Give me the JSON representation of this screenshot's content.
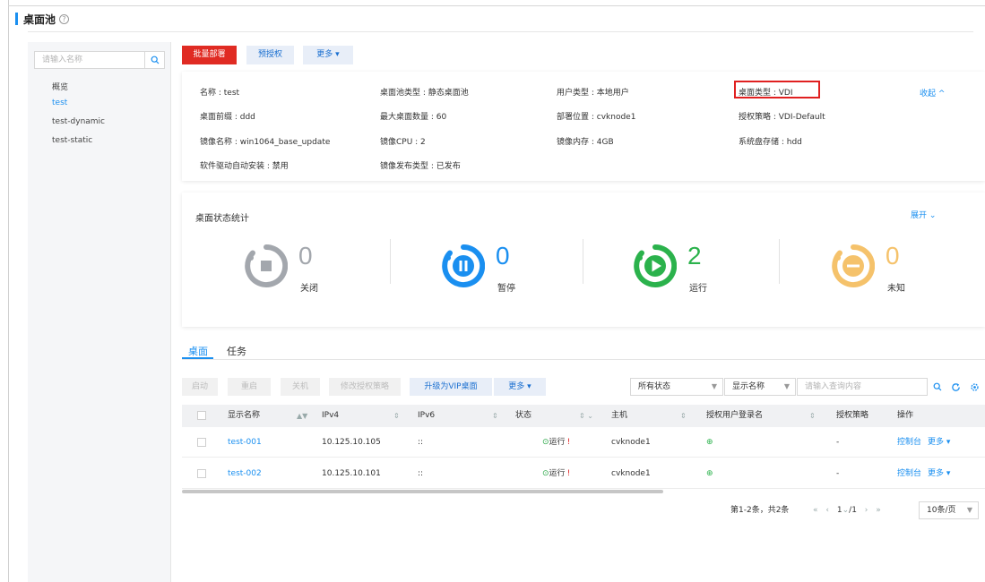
{
  "page": {
    "title": "桌面池",
    "help": "?"
  },
  "sidebar": {
    "search_placeholder": "请输入名称",
    "items": [
      {
        "label": "概览",
        "active": false
      },
      {
        "label": "test",
        "active": true
      },
      {
        "label": "test-dynamic",
        "active": false
      },
      {
        "label": "test-static",
        "active": false
      }
    ]
  },
  "toolbar": {
    "batch_deploy": "批量部署",
    "pre_authorize": "预授权",
    "more": "更多 ▾"
  },
  "info": {
    "name": "名称 : test",
    "pool_type": "桌面池类型 : 静态桌面池",
    "user_type": "用户类型 : 本地用户",
    "desktop_type": "桌面类型 : VDI",
    "collapse": "收起 ^",
    "prefix": "桌面前缀 : ddd",
    "max_count": "最大桌面数量 : 60",
    "deploy_location": "部署位置 : cvknode1",
    "auth_policy": "授权策略 : VDI-Default",
    "image_name": "镜像名称 : win1064_base_update",
    "image_cpu": "镜像CPU : 2",
    "image_mem": "镜像内存 : 4GB",
    "system_disk": "系统盘存储 : hdd",
    "driver_install": "软件驱动自动安装 : 禁用",
    "publish_type": "镜像发布类型 : 已发布"
  },
  "stats": {
    "title": "桌面状态统计",
    "expand": "展开 ⌄",
    "items": [
      {
        "label": "关闭",
        "count": "0",
        "color": "#a3a7ad"
      },
      {
        "label": "暂停",
        "count": "0",
        "color": "#1a8ff0"
      },
      {
        "label": "运行",
        "count": "2",
        "color": "#2bb24c"
      },
      {
        "label": "未知",
        "count": "0",
        "color": "#f5c26b"
      }
    ]
  },
  "tabs": {
    "desktop": "桌面",
    "task": "任务"
  },
  "actions": {
    "start": "启动",
    "restart": "重启",
    "shutdown": "关机",
    "modify_auth": "修改授权策略",
    "upgrade_vip": "升级为VIP桌面",
    "more": "更多 ▾",
    "status_filter": "所有状态",
    "field_filter": "显示名称",
    "search_placeholder": "请输入查询内容"
  },
  "table": {
    "headers": {
      "display_name": "显示名称",
      "ipv4": "IPv4",
      "ipv6": "IPv6",
      "status": "状态",
      "host": "主机",
      "auth_user": "授权用户登录名",
      "auth_policy": "授权策略",
      "ops": "操作"
    },
    "rows": [
      {
        "name": "test-001",
        "ipv4": "10.125.10.105",
        "ipv6": "::",
        "status": "运行",
        "host": "cvknode1",
        "auth_policy": "-",
        "op_console": "控制台",
        "op_more": "更多 ▾"
      },
      {
        "name": "test-002",
        "ipv4": "10.125.10.101",
        "ipv6": "::",
        "status": "运行",
        "host": "cvknode1",
        "auth_policy": "-",
        "op_console": "控制台",
        "op_more": "更多 ▾"
      }
    ]
  },
  "pagination": {
    "summary": "第1-2条，共2条",
    "current": "1",
    "total": "/1",
    "page_size": "10条/页"
  }
}
